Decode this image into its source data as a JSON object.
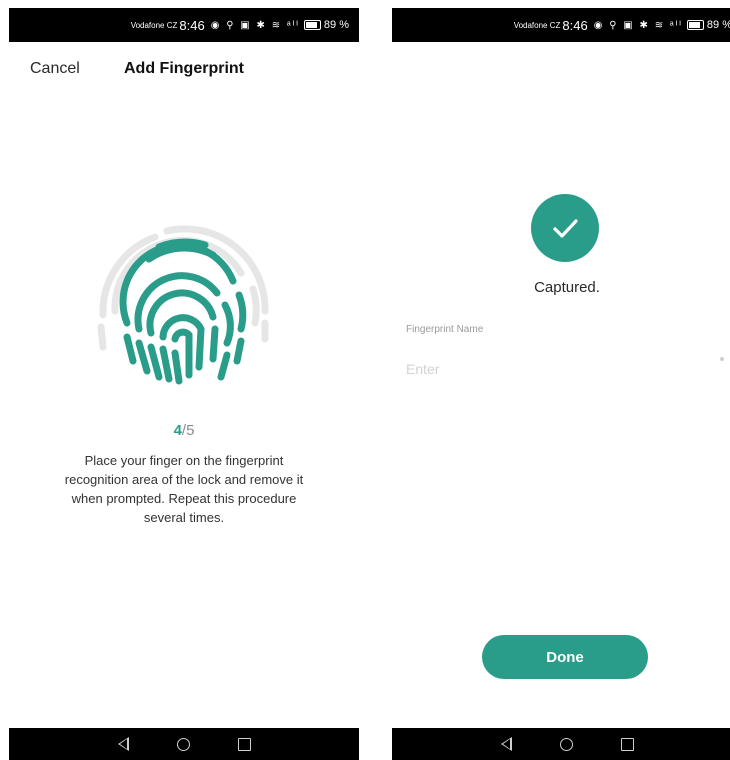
{
  "status_bar": {
    "carrier": "Vodafone CZ",
    "time": "8:46",
    "signal_icons": "◉ ⚲ ▣ ✱ ≋ ᵃᴵᴵ",
    "battery_percent": "89 %"
  },
  "enroll_screen": {
    "header": {
      "cancel_label": "Cancel",
      "title": "Add Fingerprint"
    },
    "fingerprint_icon": "fingerprint-icon",
    "progress": {
      "current": "4",
      "separator": "/",
      "total": "5"
    },
    "instructions": "Place your finger on the fingerprint recognition area of the lock and remove it when prompted. Repeat this procedure several times."
  },
  "captured_screen": {
    "check_icon": "check-icon",
    "captured_text": "Captured.",
    "name_field": {
      "label": "Fingerprint Name",
      "placeholder": "Enter",
      "value": ""
    },
    "done_label": "Done"
  },
  "colors": {
    "accent": "#2a9d8a",
    "fingerprint_inactive": "#e6e6e6",
    "system_bar": "#000000"
  }
}
